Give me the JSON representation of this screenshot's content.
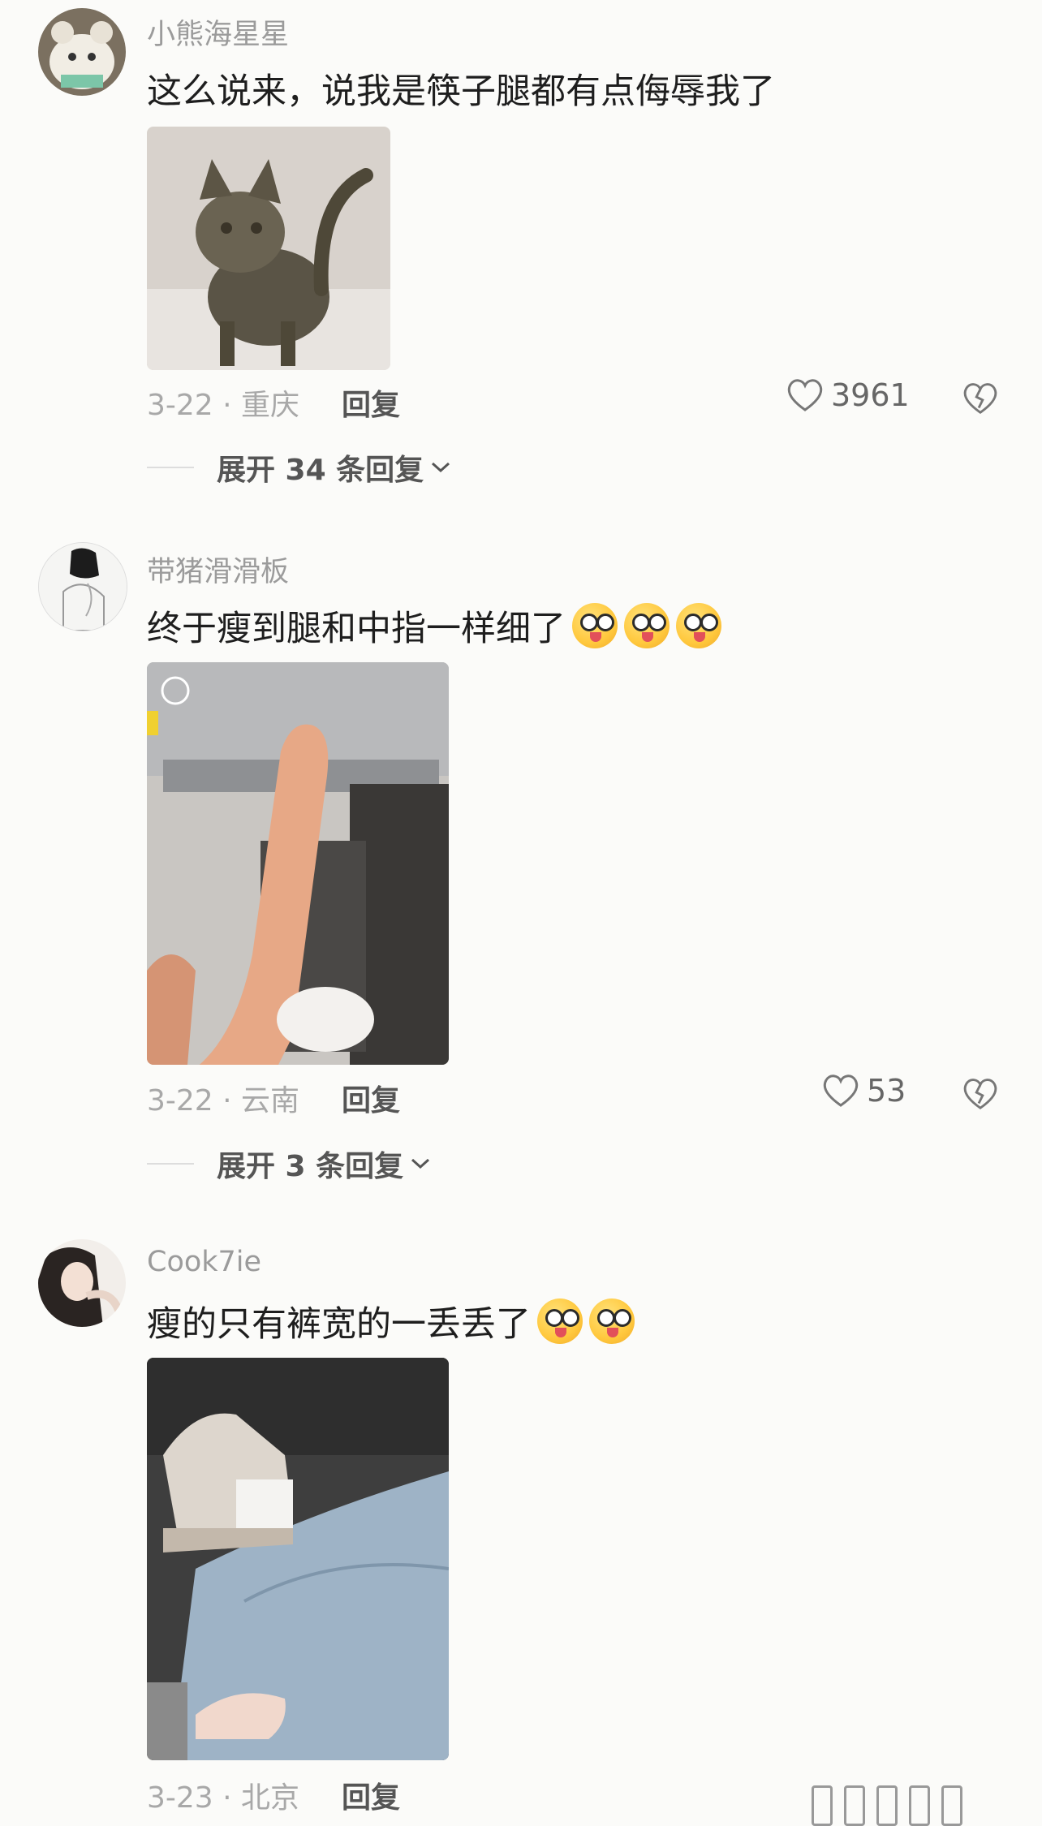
{
  "comments": [
    {
      "username": "小熊海星星",
      "text": "这么说来，说我是筷子腿都有点侮辱我了",
      "emoji_count": 0,
      "date_location": "3-22 · 重庆",
      "reply_label": "回复",
      "likes": "3961",
      "expand_label": "展开 34 条回复",
      "photo_desc": "cat-photo"
    },
    {
      "username": "带猪滑滑板",
      "text": "终于瘦到腿和中指一样细了",
      "emoji_count": 3,
      "date_location": "3-22 · 云南",
      "reply_label": "回复",
      "likes": "53",
      "expand_label": "展开 3 条回复",
      "photo_desc": "finger-photo"
    },
    {
      "username": "Cook7ie",
      "text": "瘦的只有裤宽的一丢丢了",
      "emoji_count": 2,
      "date_location": "3-23 · 北京",
      "reply_label": "回复",
      "photo_desc": "jeans-shoe-photo"
    }
  ],
  "colors": {
    "background": "#fbfbf9",
    "username": "#9b9b9b",
    "text": "#1e1e1e",
    "meta": "#a8a8a8"
  }
}
